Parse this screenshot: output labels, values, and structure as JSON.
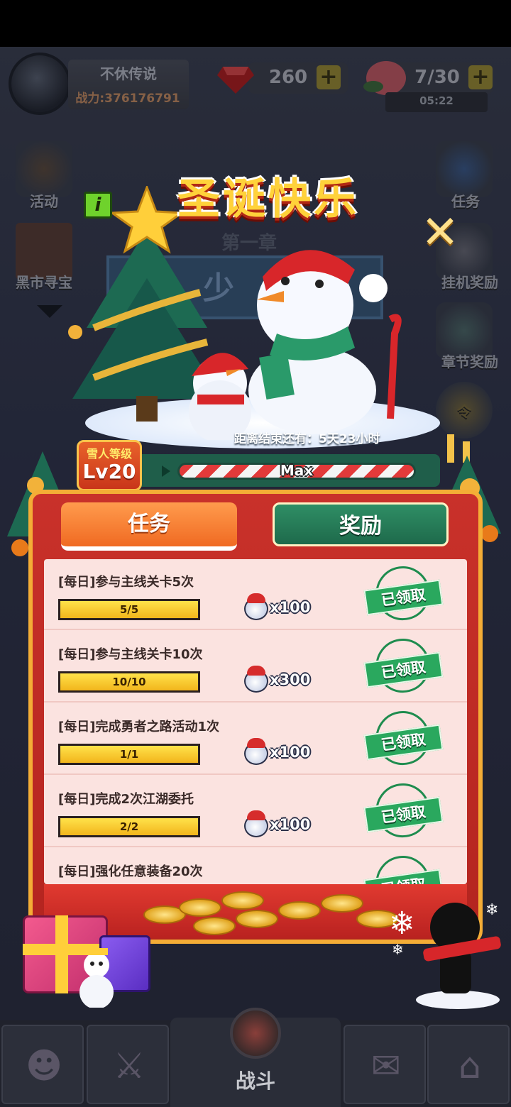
{
  "header": {
    "player_name": "不休传说",
    "combat_power_label": "战力:376176791",
    "gems_value": "260",
    "energy_value": "7/30",
    "energy_timer": "05:22",
    "plus_symbol": "+"
  },
  "side_menu": {
    "left": [
      {
        "label": "活动"
      },
      {
        "label": "黑市寻宝"
      }
    ],
    "right": [
      {
        "label": "任务"
      },
      {
        "label": "挂机奖励"
      },
      {
        "label": "章节奖励"
      },
      {
        "label": "令"
      }
    ]
  },
  "background_chapter": {
    "chapter_label": "第一章",
    "stage_partial": "少"
  },
  "event": {
    "title": "圣诞快乐",
    "info_symbol": "i",
    "close_symbol": "✕",
    "countdown": "距离结束还有：5天23小时",
    "snowman_level_label": "雪人等级",
    "snowman_level_value": "Lv20",
    "level_progress_label": "Max",
    "tabs": {
      "tasks": "任务",
      "rewards": "奖励"
    },
    "tasks": [
      {
        "title": "[每日]参与主线关卡5次",
        "progress": "5/5",
        "fraction": 1.0,
        "reward": "x100",
        "status": "已领取"
      },
      {
        "title": "[每日]参与主线关卡10次",
        "progress": "10/10",
        "fraction": 1.0,
        "reward": "x300",
        "status": "已领取"
      },
      {
        "title": "[每日]完成勇者之路活动1次",
        "progress": "1/1",
        "fraction": 1.0,
        "reward": "x100",
        "status": "已领取"
      },
      {
        "title": "[每日]完成2次江湖委托",
        "progress": "2/2",
        "fraction": 1.0,
        "reward": "x100",
        "status": "已领取"
      },
      {
        "title": "[每日]强化任意装备20次",
        "progress": "",
        "fraction": 1.0,
        "reward": "",
        "status": "已领取"
      }
    ],
    "reward_icon": "snowman-head-icon"
  },
  "bottom_nav": {
    "battle_label": "战斗"
  },
  "colors": {
    "accent_orange": "#f06a22",
    "accent_green": "#2aa85e",
    "frame_red": "#c9312a",
    "gold": "#ffd23a"
  }
}
